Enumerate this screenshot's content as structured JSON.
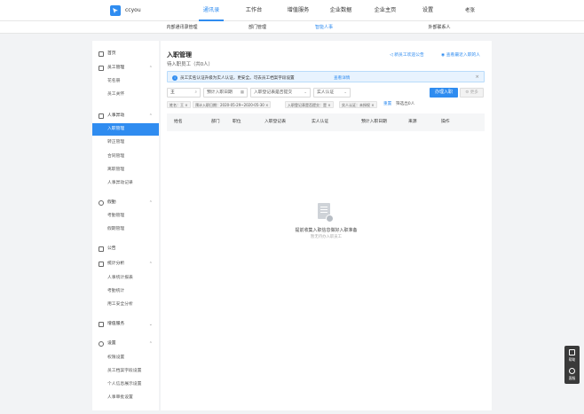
{
  "app": {
    "brand": "ccyou"
  },
  "topnav": [
    "通讯录",
    "工作台",
    "增值服务",
    "企业数据",
    "企业主页",
    "设置"
  ],
  "user": {
    "name": "老张"
  },
  "subnav": [
    "内部通讯录管理",
    "部门管理",
    "智能人事",
    "外部联系人"
  ],
  "sidebar": {
    "home": "首页",
    "staff": {
      "title": "员工管理",
      "items": [
        "花名册",
        "员工关怀"
      ]
    },
    "hr": {
      "title": "人事异动",
      "items": [
        "入职管理",
        "转正管理",
        "合同管理",
        "离职管理",
        "人事异动记录"
      ]
    },
    "attendance": {
      "title": "假勤",
      "items": [
        "考勤管理",
        "假期管理"
      ]
    },
    "notice": "公告",
    "stats": {
      "title": "统计分析",
      "items": [
        "人事统计报表",
        "考勤统计",
        "用工安全分析"
      ]
    },
    "value": {
      "title": "增值服务"
    },
    "settings": {
      "title": "设置",
      "items": [
        "权限设置",
        "员工档案字段设置",
        "个人信息展示设置",
        "人事审批设置"
      ]
    }
  },
  "main": {
    "title": "入职管理",
    "subtitle": "待入职员工（共0人）",
    "welcome_link": "新员工欢迎公告",
    "recent_link": "查看最近入职的人",
    "notice": {
      "text": "员工实名认证升级为实人认证，更安全。可去员工档案字段设置",
      "link": "查看详情"
    },
    "filters": {
      "name_value": "王",
      "date_placeholder": "预计入职日期",
      "form_placeholder": "入职登记表是否提交",
      "auth_placeholder": "实人认证"
    },
    "primary_button": "办理入职",
    "more_button": "更多",
    "tags": [
      "姓名：王",
      "预计入职日期：2020-05-29~2020-05-30",
      "入职登记表是否提交：是",
      "实人认证：未授权"
    ],
    "reset": "重置",
    "count": "筛选出0人",
    "columns": [
      "姓名",
      "部门",
      "职位",
      "入职登记表",
      "实人认证",
      "预计入职日期",
      "来源",
      "操作"
    ],
    "empty": {
      "title": "提前收集入职信息做好入职准备",
      "sub": "暂无待办入职员工"
    }
  },
  "float": [
    "帮助",
    "客服"
  ]
}
